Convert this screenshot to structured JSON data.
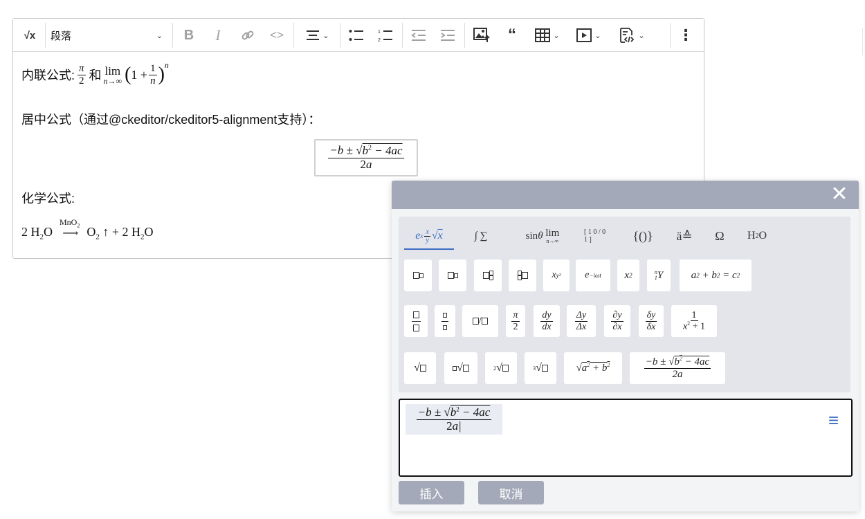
{
  "toolbar": {
    "math_icon": "√x",
    "paragraph_label": "段落",
    "bold": "B",
    "italic": "I",
    "link_icon": "link-icon",
    "code": "<>",
    "more": "⋮"
  },
  "content": {
    "inline_label": "内联公式:",
    "inline_and": "和",
    "center_label": "居中公式（通过@ckeditor/ckeditor5-alignment支持）：",
    "chem_label": "化学公式:"
  },
  "dialog": {
    "close": "✕",
    "tabs": [
      "e^x x/y √x",
      "∫ ∑",
      "sinθ lim",
      "[matrix]",
      "{()}",
      "ä≙",
      "Ω",
      "H₂O"
    ],
    "insert_label": "插入",
    "cancel_label": "取消"
  }
}
